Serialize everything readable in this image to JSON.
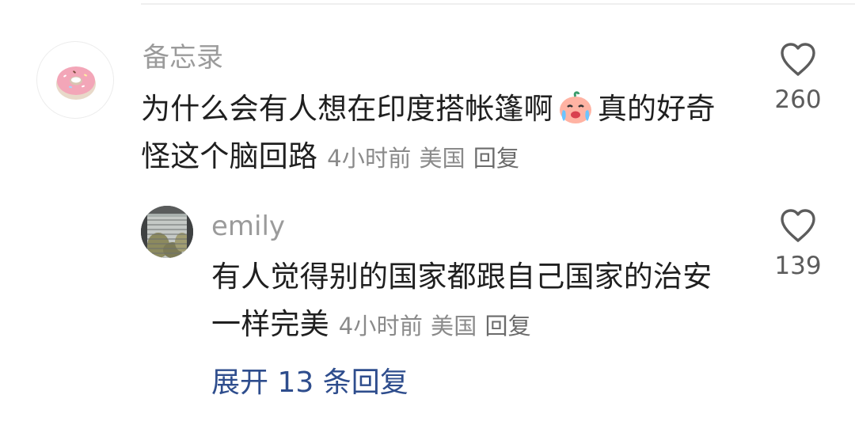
{
  "comment": {
    "username": "备忘录",
    "text_part1": "为什么会有人想在印度搭帐篷啊",
    "emoji": "crying-face-emoji",
    "text_part2": "真的好奇怪这个脑回路",
    "time": "4小时前",
    "location": "美国",
    "reply_label": "回复",
    "likes": "260"
  },
  "reply": {
    "username": "emily",
    "text": "有人觉得别的国家都跟自己国家的治安一样完美",
    "time": "4小时前",
    "location": "美国",
    "reply_label": "回复",
    "likes": "139"
  },
  "expand_replies_label": "展开 13 条回复",
  "colors": {
    "text_primary": "#1f1f1f",
    "text_meta": "#8a8a8a",
    "username": "#9b9b9b",
    "link": "#2e4d8d",
    "heart_outline": "#5c5c5c"
  }
}
